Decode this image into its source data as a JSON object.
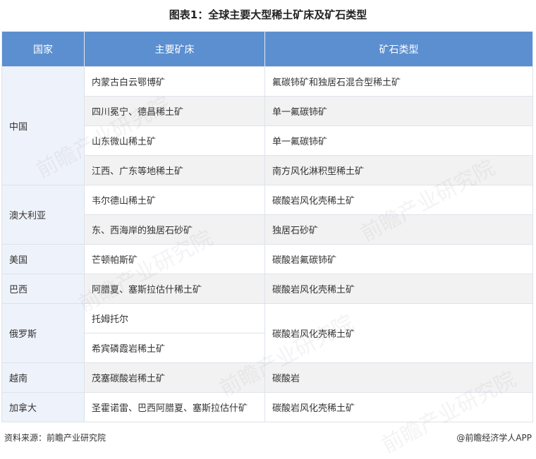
{
  "title": "图表1：全球主要大型稀土矿床及矿石类型",
  "headers": {
    "country": "国家",
    "deposit": "主要矿床",
    "ore": "矿石类型"
  },
  "rows": [
    {
      "country": "中国",
      "deposit": "内蒙古白云鄂博矿",
      "ore": "氟碳铈矿和独居石混合型稀土矿"
    },
    {
      "deposit": "四川冕宁、德昌稀土矿",
      "ore": "单一氟碳铈矿"
    },
    {
      "deposit": "山东微山稀土矿",
      "ore": "单一氟碳铈矿"
    },
    {
      "deposit": "江西、广东等地稀土矿",
      "ore": "南方风化淋积型稀土矿"
    },
    {
      "country": "澳大利亚",
      "deposit": "韦尔德山稀土矿",
      "ore": "碳酸岩风化壳稀土矿"
    },
    {
      "deposit": "东、西海岸的独居石砂矿",
      "ore": "独居石砂矿"
    },
    {
      "country": "美国",
      "deposit": "芒顿帕斯矿",
      "ore": "碳酸岩氟碳铈矿"
    },
    {
      "country": "巴西",
      "deposit": "阿腊夏、塞斯拉估什稀土矿",
      "ore": "碳酸岩风化壳稀土矿"
    },
    {
      "country": "俄罗斯",
      "deposit": "托姆托尔",
      "ore": "碳酸岩风化壳稀土矿"
    },
    {
      "deposit": "希宾磷霞岩稀土矿"
    },
    {
      "country": "越南",
      "deposit": "茂塞碳酸岩稀土矿",
      "ore": "碳酸岩"
    },
    {
      "country": "加拿大",
      "deposit": "圣霍诺雷、巴西阿腊夏、塞斯拉估什矿",
      "ore": "碳酸岩风化壳稀土矿"
    }
  ],
  "footer": {
    "source": "资料来源：前瞻产业研究院",
    "brand": "@前瞻经济学人APP"
  },
  "watermark": "前瞻产业研究院",
  "colors": {
    "header_bg": "#5b8fd0",
    "country_bg": "#eef2fa",
    "alt_row_bg": "#f2f2f2"
  }
}
